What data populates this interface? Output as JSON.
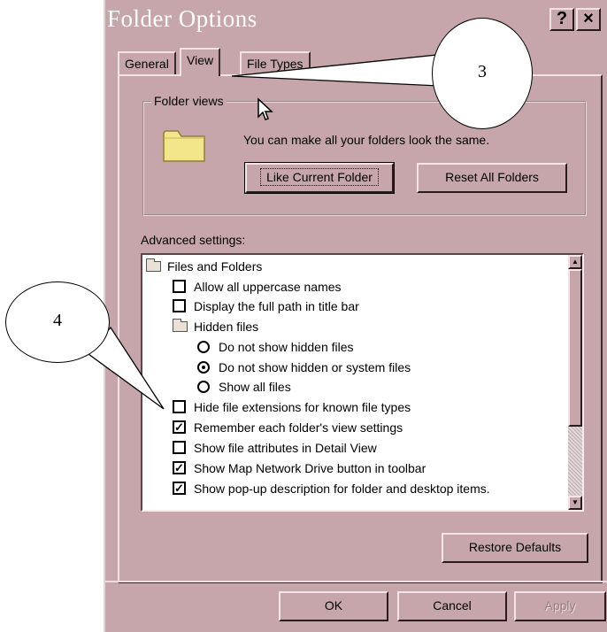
{
  "dialog": {
    "title": "Folder Options",
    "help_button": "?",
    "close_button": "×"
  },
  "tabs": [
    {
      "label": "General",
      "active": false
    },
    {
      "label": "View",
      "active": true
    },
    {
      "label": "File Types",
      "active": false
    }
  ],
  "folder_views": {
    "legend": "Folder views",
    "description": "You can make all your folders look the same.",
    "like_current_button": "Like Current Folder",
    "reset_all_button": "Reset All Folders",
    "icon": "folder-icon"
  },
  "advanced": {
    "label": "Advanced settings:",
    "items": [
      {
        "kind": "folder",
        "label": "Files and Folders"
      },
      {
        "kind": "checkbox",
        "checked": false,
        "label": "Allow all uppercase names"
      },
      {
        "kind": "checkbox",
        "checked": false,
        "label": "Display the full path in title bar"
      },
      {
        "kind": "folder",
        "label": "Hidden files"
      },
      {
        "kind": "radio",
        "selected": false,
        "label": "Do not show hidden files"
      },
      {
        "kind": "radio",
        "selected": true,
        "label": "Do not show hidden or system files"
      },
      {
        "kind": "radio",
        "selected": false,
        "label": "Show all files"
      },
      {
        "kind": "checkbox",
        "checked": false,
        "label": "Hide file extensions for known file types"
      },
      {
        "kind": "checkbox",
        "checked": true,
        "label": "Remember each folder's view settings"
      },
      {
        "kind": "checkbox",
        "checked": false,
        "label": "Show file attributes in Detail View"
      },
      {
        "kind": "checkbox",
        "checked": true,
        "label": "Show Map Network Drive button in toolbar"
      },
      {
        "kind": "checkbox",
        "checked": true,
        "label": "Show pop-up description for folder and desktop items."
      }
    ],
    "restore_defaults_button": "Restore Defaults"
  },
  "footer": {
    "ok_button": "OK",
    "cancel_button": "Cancel",
    "apply_button": "Apply"
  },
  "annotations": {
    "callout_3": "3",
    "callout_4": "4"
  },
  "colors": {
    "dialog_face": "#c7a6ab",
    "list_background": "#ffffff"
  }
}
